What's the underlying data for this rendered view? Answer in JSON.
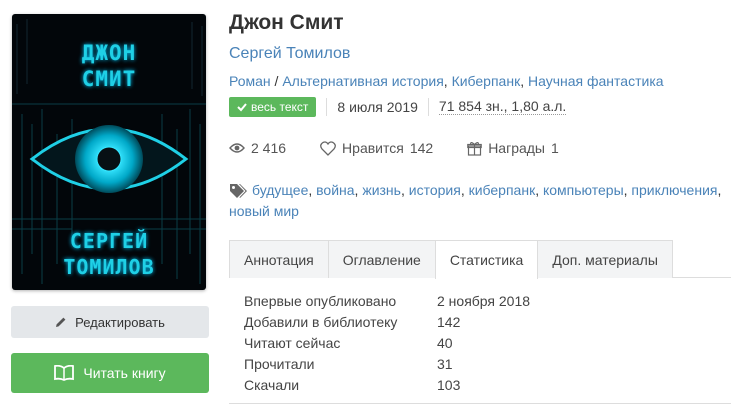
{
  "cover": {
    "title_line1": "ДЖОН",
    "title_line2": "СМИТ",
    "author_line1": "СЕРГЕЙ",
    "author_line2": "ТОМИЛОВ",
    "accent_color": "#1fd0e6"
  },
  "buttons": {
    "edit_label": "Редактировать",
    "read_label": "Читать книгу",
    "edit_icon": "pencil-icon",
    "read_icon": "book-icon"
  },
  "book": {
    "title": "Джон Смит",
    "author": "Сергей Томилов",
    "genres": [
      "Роман",
      "Альтернативная история",
      "Киберпанк",
      "Научная фантастика"
    ],
    "genre_separator_1": " / ",
    "genre_separator_2": ", ",
    "genre_separator_3": ", ",
    "badge": "весь текст",
    "date": "8 июля 2019",
    "size": "71 854 зн., 1,80 а.л."
  },
  "stats": {
    "views": "2 416",
    "likes_label": "Нравится",
    "likes": "142",
    "awards_label": "Награды",
    "awards": "1"
  },
  "tags": [
    "будущее",
    "война",
    "жизнь",
    "история",
    "киберпанк",
    "компьютеры",
    "приключения",
    "новый мир"
  ],
  "tabs": {
    "annotation": "Аннотация",
    "contents": "Оглавление",
    "statistics": "Статистика",
    "extras": "Доп. материалы"
  },
  "stat_table": [
    {
      "label": "Впервые опубликовано",
      "value": "2 ноября 2018"
    },
    {
      "label": "Добавили в библиотеку",
      "value": "142"
    },
    {
      "label": "Читают сейчас",
      "value": "40"
    },
    {
      "label": "Прочитали",
      "value": "31"
    },
    {
      "label": "Скачали",
      "value": "103"
    }
  ],
  "colors": {
    "link": "#4a83b8",
    "green": "#5cb85c"
  }
}
